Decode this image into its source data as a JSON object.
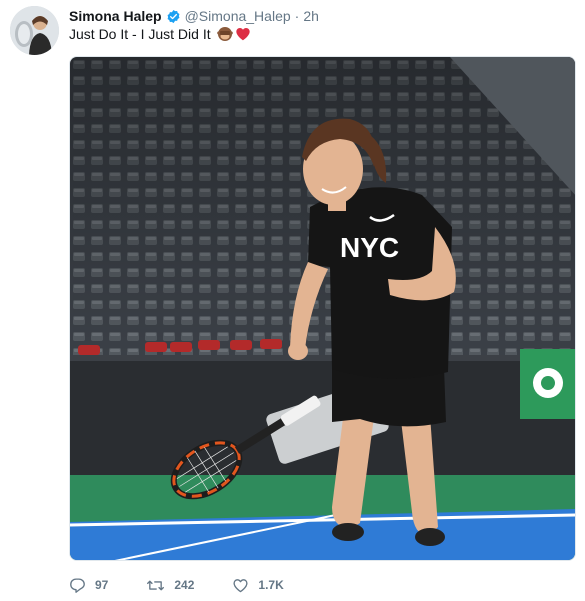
{
  "tweet": {
    "display_name": "Simona Halep",
    "handle": "@Simona_Halep",
    "separator": "·",
    "timestamp": "2h",
    "text": "Just Do It - I Just Did It",
    "emoji_icons": [
      "see-no-evil-monkey-icon",
      "red-heart-icon"
    ],
    "verified_icon": "verified-badge-icon",
    "media_alt": "Photo",
    "media_visible_text": [
      "NYC"
    ]
  },
  "actions": {
    "reply_count": "97",
    "retweet_count": "242",
    "like_count": "1.7K"
  },
  "colors": {
    "verified": "#1da1f2",
    "secondary_text": "#657786",
    "court_blue": "#2f7bd6",
    "court_green": "#2d8b5f",
    "heart": "#e0245e"
  }
}
